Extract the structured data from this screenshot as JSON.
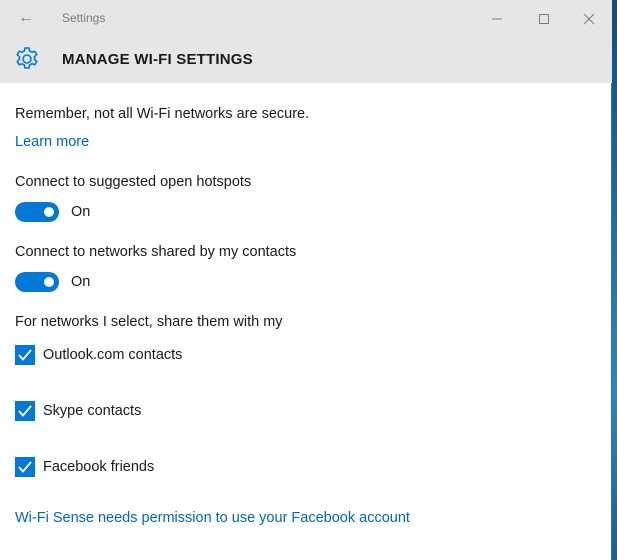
{
  "window": {
    "title": "Settings",
    "controls": [
      "minimize",
      "maximize",
      "close"
    ],
    "back_icon": "back-arrow-icon"
  },
  "header": {
    "icon": "gear-icon",
    "title": "MANAGE WI-FI SETTINGS"
  },
  "main": {
    "warning": "Remember, not all Wi-Fi networks are secure.",
    "learn_more": "Learn more",
    "hotspots": {
      "label": "Connect to suggested open hotspots",
      "state": "On"
    },
    "contacts_networks": {
      "label": "Connect to networks shared by my contacts",
      "state": "On"
    },
    "share_label": "For networks I select, share them with my",
    "share_options": [
      {
        "label": "Outlook.com contacts",
        "checked": true
      },
      {
        "label": "Skype contacts",
        "checked": true
      },
      {
        "label": "Facebook friends",
        "checked": true
      }
    ],
    "facebook_permission": "Wi-Fi Sense needs permission to use your Facebook account"
  },
  "colors": {
    "accent": "#0078d7",
    "link": "#0067b8",
    "titlebar": "#e6e6e6"
  }
}
